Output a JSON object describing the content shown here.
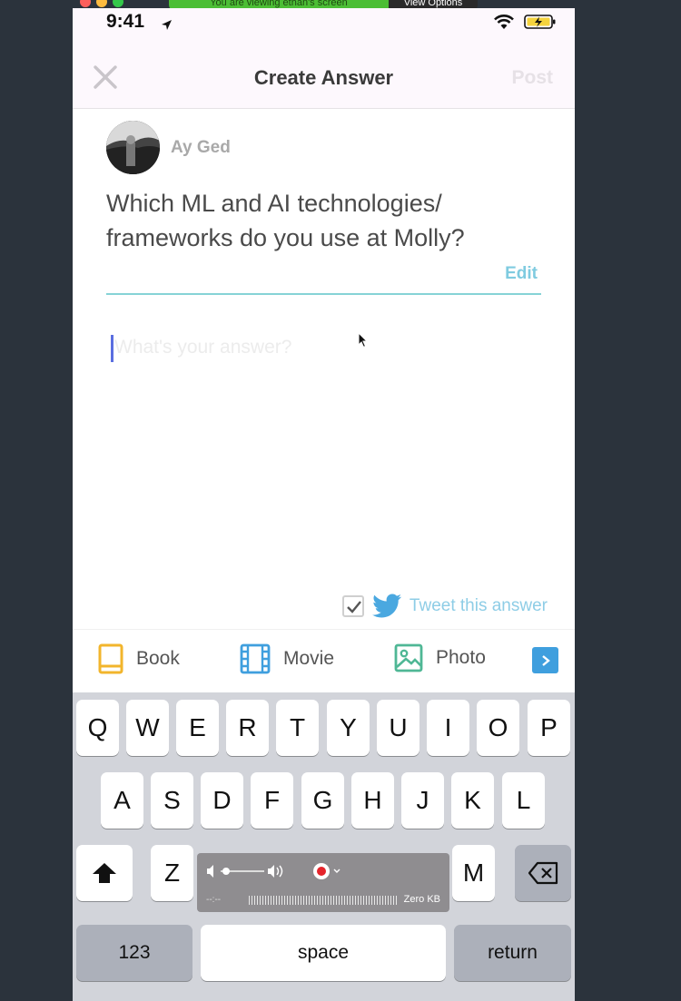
{
  "share_bar": {
    "message": "You are viewing ethan's screen",
    "view_options_label": "View Options"
  },
  "status_bar": {
    "time": "9:41"
  },
  "nav": {
    "title": "Create Answer",
    "post_label": "Post"
  },
  "question": {
    "author": "Ay Ged",
    "text": "Which ML and AI technologies/ frameworks do you use at Molly?",
    "edit_label": "Edit"
  },
  "answer": {
    "placeholder": "What's your answer?"
  },
  "tweet": {
    "label": "Tweet this answer",
    "checked": true
  },
  "attachments": [
    {
      "label": "Book"
    },
    {
      "label": "Movie"
    },
    {
      "label": "Photo"
    }
  ],
  "keyboard": {
    "row1": [
      "Q",
      "W",
      "E",
      "R",
      "T",
      "Y",
      "U",
      "I",
      "O",
      "P"
    ],
    "row2": [
      "A",
      "S",
      "D",
      "F",
      "G",
      "H",
      "J",
      "K",
      "L"
    ],
    "row3_left": "Z",
    "row3_right": "M",
    "numbers_label": "123",
    "space_label": "space",
    "return_label": "return"
  },
  "recorder": {
    "time": "--:--",
    "size": "Zero KB"
  },
  "colors": {
    "accent_teal": "#86d3d6",
    "twitter_blue": "#4aa8e0",
    "book_yellow": "#f2b52c",
    "movie_blue": "#3f9fde",
    "photo_green": "#4fb795",
    "share_green": "#4cbe35"
  }
}
